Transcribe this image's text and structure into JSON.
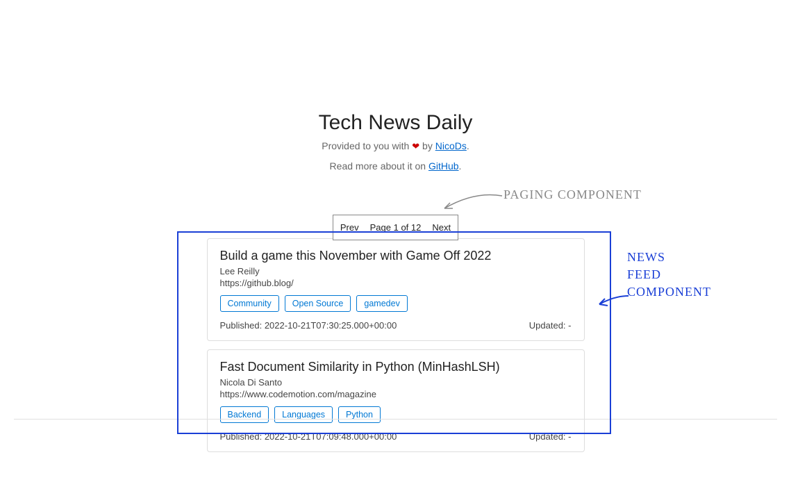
{
  "header": {
    "title": "Tech News Daily",
    "subtitle_prefix": "Provided to you with ",
    "subtitle_by": " by ",
    "author_link": "NicoDs",
    "subtitle_suffix": ".",
    "readmore_prefix": "Read more about it on ",
    "readmore_link": "GitHub",
    "readmore_suffix": "."
  },
  "pagination": {
    "prev": "Prev",
    "page_label": "Page 1 of 12",
    "next": "Next"
  },
  "feed": [
    {
      "title": "Build a game this November with Game Off 2022",
      "author": "Lee Reilly",
      "source": "https://github.blog/",
      "tags": [
        "Community",
        "Open Source",
        "gamedev"
      ],
      "published_prefix": "Published: ",
      "published": "2022-10-21T07:30:25.000+00:00",
      "updated_prefix": "Updated: ",
      "updated": "-"
    },
    {
      "title": "Fast Document Similarity in Python (MinHashLSH)",
      "author": "Nicola Di Santo",
      "source": "https://www.codemotion.com/magazine",
      "tags": [
        "Backend",
        "Languages",
        "Python"
      ],
      "published_prefix": "Published: ",
      "published": "2022-10-21T07:09:48.000+00:00",
      "updated_prefix": "Updated: ",
      "updated": "-"
    }
  ],
  "annotations": {
    "paging": "PAGING COMPONENT",
    "feed_line1": "NEWS",
    "feed_line2": "FEED",
    "feed_line3": "COMPONENT"
  }
}
